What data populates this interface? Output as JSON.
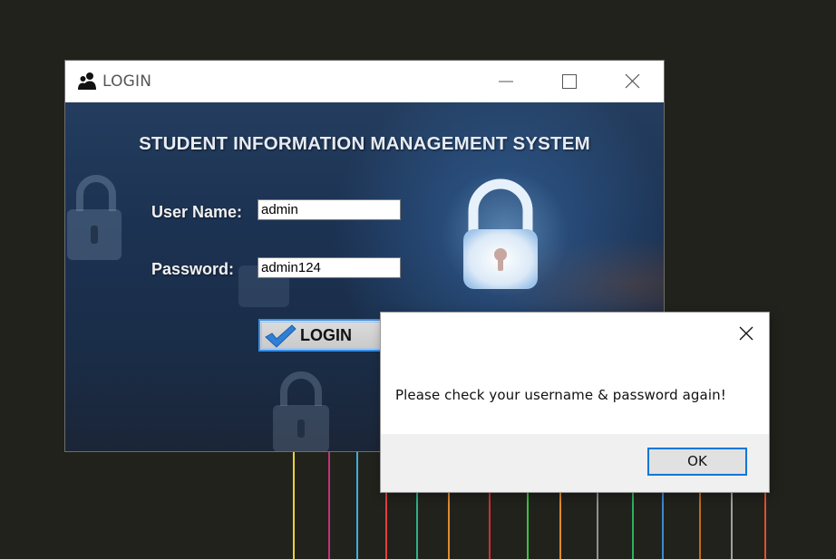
{
  "login_window": {
    "title": "LOGIN",
    "heading": "STUDENT INFORMATION MANAGEMENT SYSTEM",
    "username_label": "User Name:",
    "username_value": "admin",
    "password_label": "Password:",
    "password_value": "admin124",
    "login_button": "LOGIN",
    "icons": [
      "users-icon",
      "minimize-icon",
      "maximize-icon",
      "close-icon",
      "padlock-icon",
      "checkmark-icon"
    ]
  },
  "message_box": {
    "message": "Please check your username & password again!",
    "ok_button": "OK",
    "icons": [
      "close-icon"
    ]
  },
  "colors": {
    "desktop": "#22221d",
    "accent": "#0078d7",
    "login_bg": "#1c3252"
  }
}
